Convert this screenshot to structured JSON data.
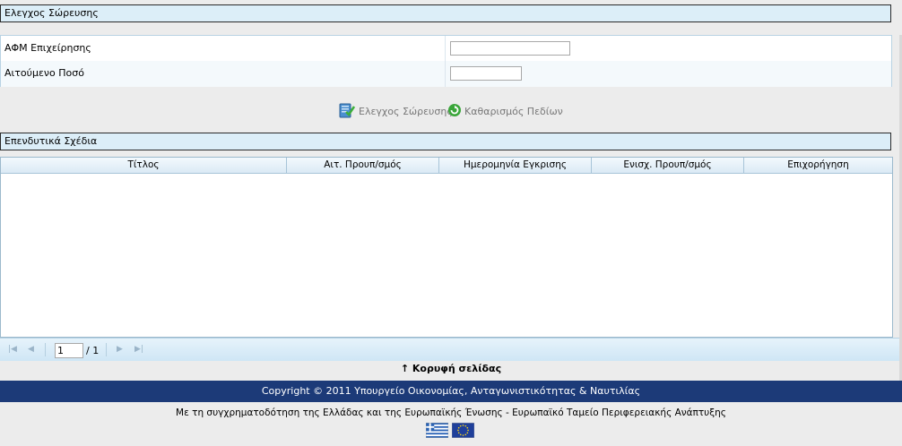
{
  "section_check": {
    "title": "Ελεγχος Σώρευσης"
  },
  "form": {
    "afm_label": "ΑΦΜ Επιχείρησης",
    "afm_value": "",
    "amount_label": "Αιτούμενο Ποσό",
    "amount_value": ""
  },
  "actions": {
    "check_label": "Ελεγχος Σώρευσης",
    "clear_label": "Καθαρισμός Πεδίων"
  },
  "section_plans": {
    "title": "Επενδυτικά Σχέδια"
  },
  "table": {
    "columns": [
      "Τίτλος",
      "Αιτ. Προυπ/σμός",
      "Ημερομηνία Εγκρισης",
      "Ενισχ. Προυπ/σμός",
      "Επιχορήγηση"
    ],
    "rows": []
  },
  "pager": {
    "page": "1",
    "total_label": "/ 1"
  },
  "back_to_top": "↑ Κορυφή σελίδας",
  "footer": {
    "copyright": "Copyright © 2011 Υπουργείο Οικονομίας, Ανταγωνιστικότητας & Ναυτιλίας",
    "cofunding": "Με τη συγχρηματοδότηση της Ελλάδας και της Ευρωπαϊκής Ένωσης - Ευρωπαϊκό Ταμείο Περιφερειακής Ανάπτυξης"
  },
  "colors": {
    "header_bg": "#dceef8",
    "footer_blue": "#1c3a78",
    "greek_flag_blue": "#2b63b5",
    "eu_flag_blue": "#1f3f9a",
    "eu_star_yellow": "#f5d21a"
  }
}
